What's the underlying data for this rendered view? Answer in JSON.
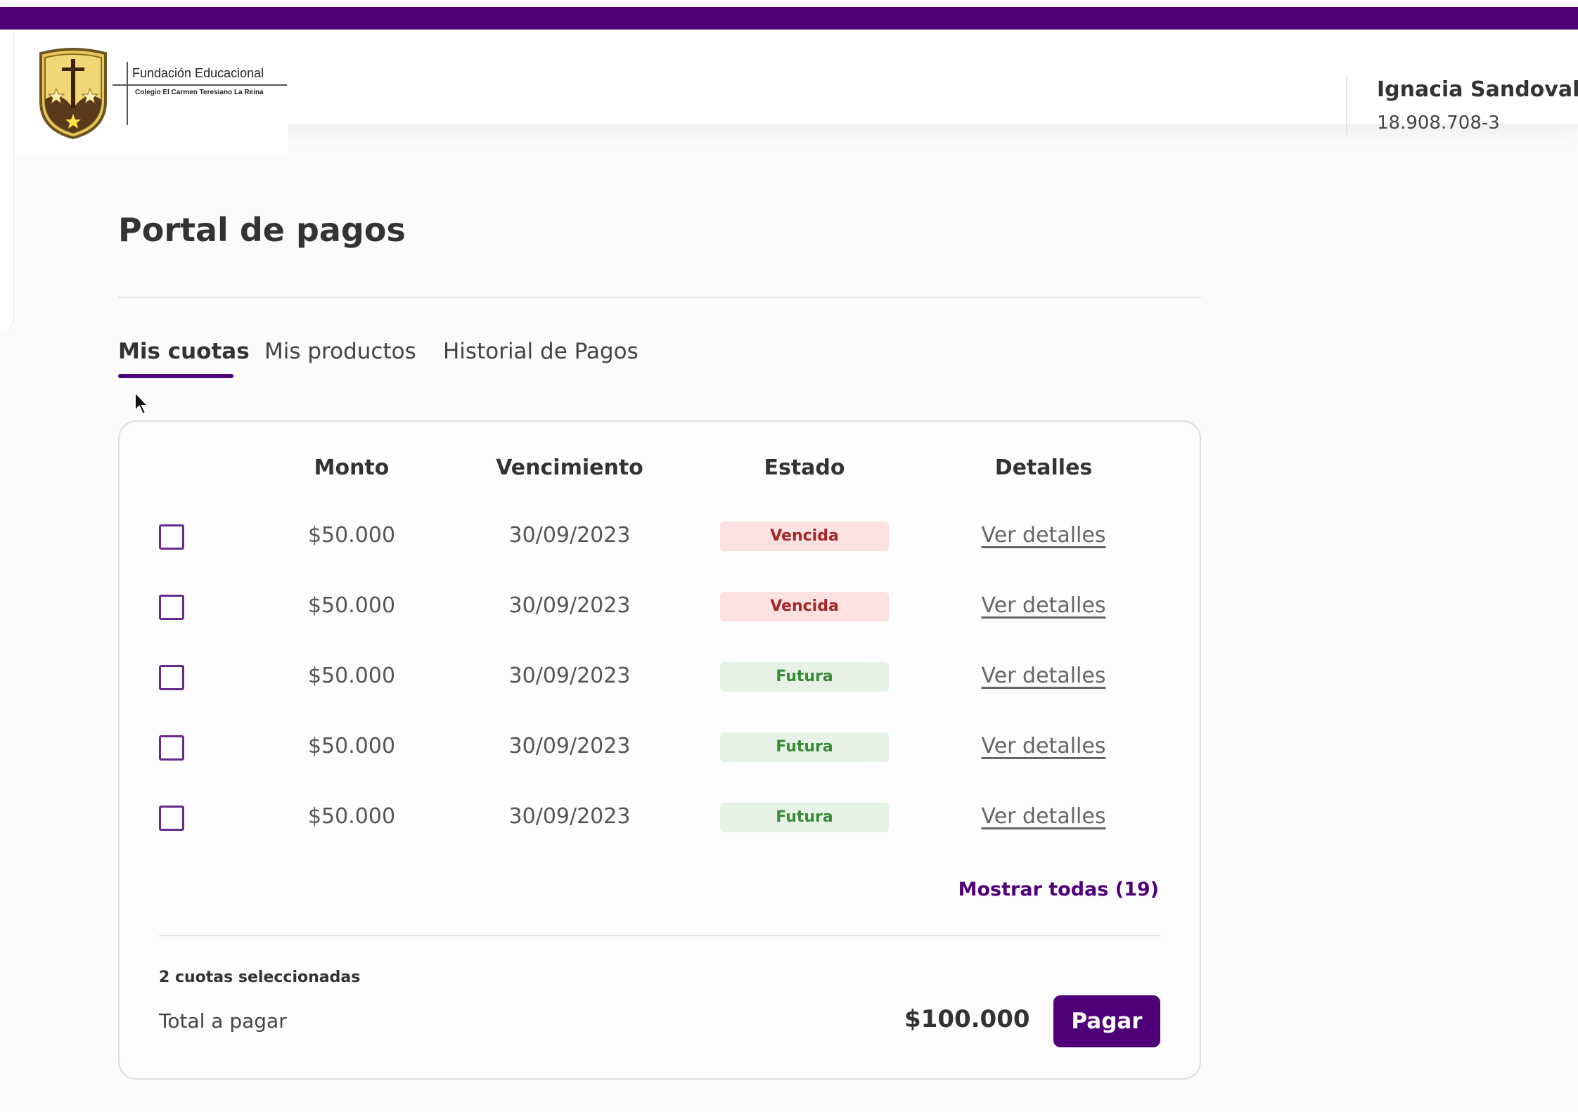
{
  "header": {
    "logo_title": "Fundación Educacional",
    "logo_subtitle": "Colegio El Carmen Teresiano La Reina",
    "user_name": "Ignacia Sandoval",
    "user_rut": "18.908.708-3"
  },
  "page": {
    "title": "Portal de pagos"
  },
  "tabs": [
    {
      "label": "Mis cuotas",
      "active": true
    },
    {
      "label": "Mis productos",
      "active": false
    },
    {
      "label": "Historial de Pagos",
      "active": false
    }
  ],
  "table": {
    "headers": {
      "amount": "Monto",
      "due_date": "Vencimiento",
      "status": "Estado",
      "details": "Detalles"
    },
    "rows": [
      {
        "amount": "$50.000",
        "due_date": "30/09/2023",
        "status": "Vencida",
        "details": "Ver detalles"
      },
      {
        "amount": "$50.000",
        "due_date": "30/09/2023",
        "status": "Vencida",
        "details": "Ver detalles"
      },
      {
        "amount": "$50.000",
        "due_date": "30/09/2023",
        "status": "Futura",
        "details": "Ver detalles"
      },
      {
        "amount": "$50.000",
        "due_date": "30/09/2023",
        "status": "Futura",
        "details": "Ver detalles"
      },
      {
        "amount": "$50.000",
        "due_date": "30/09/2023",
        "status": "Futura",
        "details": "Ver detalles"
      }
    ],
    "show_all": "Mostrar todas (19)"
  },
  "summary": {
    "selected_count": "2 cuotas seleccionadas",
    "total_label": "Total a pagar",
    "total_amount": "$100.000",
    "pay_label": "Pagar"
  },
  "colors": {
    "brand": "#4f0078",
    "overdue_bg": "#fbe1e1",
    "overdue_text": "#a32727",
    "future_bg": "#e5f2e5",
    "future_text": "#3a8a3a"
  }
}
